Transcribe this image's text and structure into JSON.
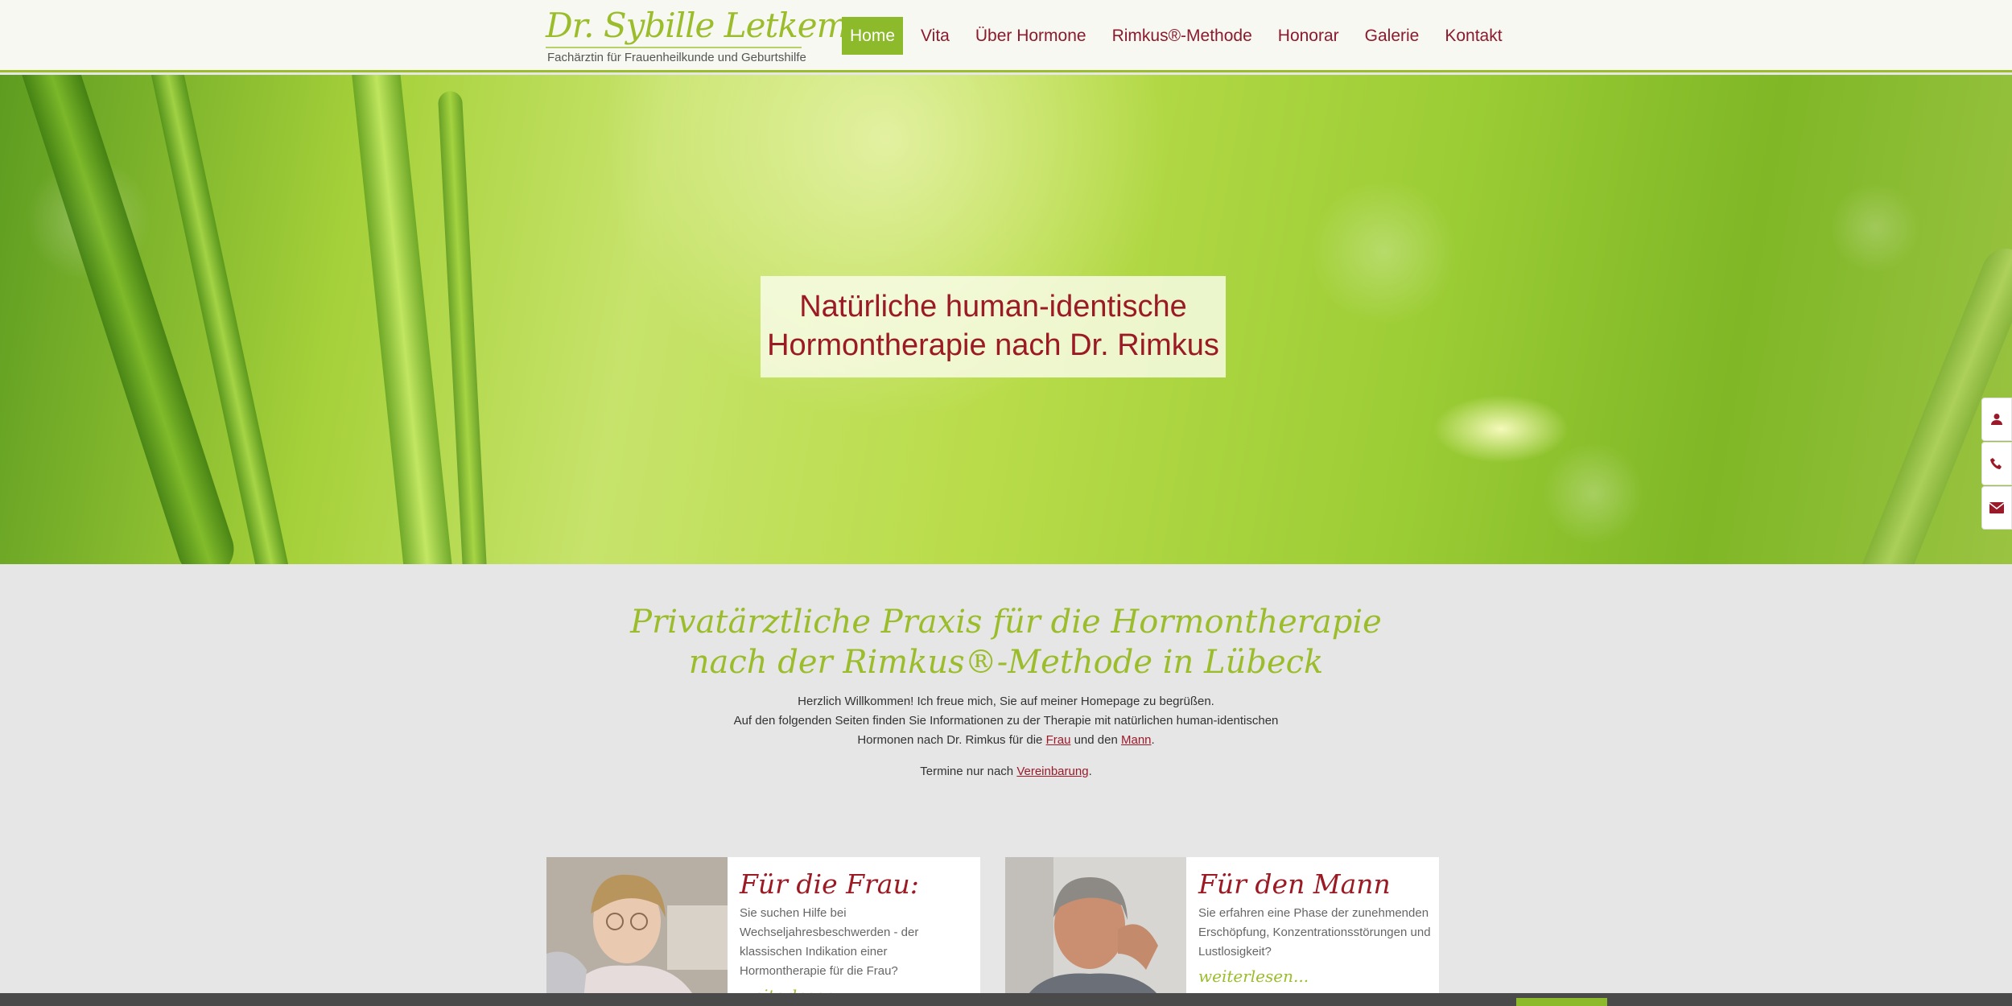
{
  "header": {
    "logo_name": "Dr. Sybille Letkeman",
    "logo_subtitle": "Fachärztin für Frauenheilkunde und Geburtshilfe",
    "nav": [
      {
        "label": "Home",
        "active": true
      },
      {
        "label": "Vita"
      },
      {
        "label": "Über Hormone"
      },
      {
        "label": "Rimkus®-Methode"
      },
      {
        "label": "Honorar"
      },
      {
        "label": "Galerie"
      },
      {
        "label": "Kontakt"
      }
    ]
  },
  "hero": {
    "title_line1": "Natürliche human-identische",
    "title_line2": "Hormontherapie nach Dr. Rimkus"
  },
  "side_tabs": [
    {
      "icon": "user-icon"
    },
    {
      "icon": "phone-icon"
    },
    {
      "icon": "envelope-icon"
    }
  ],
  "intro": {
    "heading_line1": "Privatärztliche Praxis für die Hormontherapie",
    "heading_line2": "nach der Rimkus®-Methode in Lübeck",
    "line1": "Herzlich Willkommen! Ich freue mich, Sie auf meiner Homepage zu begrüßen.",
    "line2": "Auf den folgenden Seiten finden Sie Informationen zu der Therapie mit natürlichen human-identischen",
    "line3_before": "Hormonen nach Dr. Rimkus für die ",
    "link_frau": "Frau",
    "line3_middle": " und den ",
    "link_mann": "Mann",
    "line3_after": ".",
    "appointment_before": "Termine nur nach ",
    "appointment_link": "Vereinbarung",
    "appointment_after": "."
  },
  "cards": [
    {
      "title": "Für die Frau:",
      "text": "Sie suchen Hilfe bei Wechseljahresbeschwerden - der klassischen Indikation einer Hormontherapie für die Frau?",
      "more": "weiterlesen..."
    },
    {
      "title": "Für den Mann",
      "text": "Sie erfahren eine Phase der zunehmenden Erschöpfung, Konzentrationsstörungen und Lustlosigkeit?",
      "more": "weiterlesen..."
    }
  ],
  "colors": {
    "accent_green": "#8cba2a",
    "brand_red": "#9b1a24",
    "script_green": "#9bbd2c"
  }
}
